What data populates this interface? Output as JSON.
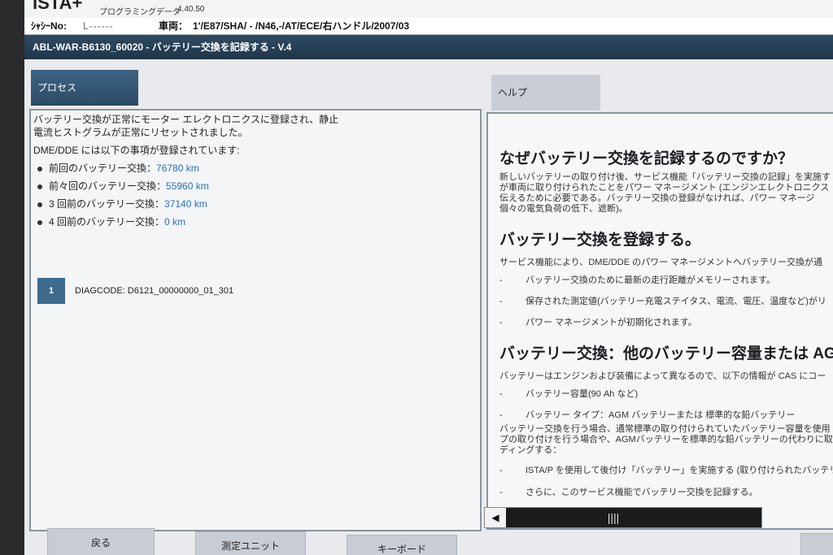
{
  "app": {
    "logo": "ISTA+",
    "subtitle": "プログラミングデータ",
    "version": "4.40.50"
  },
  "vehicle": {
    "vin_label": "ｼｬｼｰNo:",
    "vin_value": "L------",
    "model_label": "車両：",
    "model_value": "1'/E87/SHA/ - /N46,-/AT/ECE/右ハンドル/2007/03"
  },
  "title": "ABL-WAR-B6130_60020 - バッテリー交換を記録する - V.4",
  "tabs": {
    "process": "プロセス",
    "help": "ヘルプ"
  },
  "process": {
    "message": "バッテリー交換が正常にモーター エレクトロニクスに登録され、静止電流ヒストグラムが正常にリセットされました。",
    "subheading": "DME/DDE には以下の事項が登録されています:",
    "history": [
      {
        "label": "前回のバッテリー交換：",
        "km": "76780 km"
      },
      {
        "label": "前々回のバッテリー交換：",
        "km": "55960 km"
      },
      {
        "label": "3 回前のバッテリー交換：",
        "km": "37140 km"
      },
      {
        "label": "4 回前のバッテリー交換：",
        "km": "0 km"
      }
    ],
    "diag_index": "1",
    "diag_code": "DIAGCODE: D6121_00000000_01_301"
  },
  "help": {
    "h1": "なぜバッテリー交換を記録するのですか？",
    "p1": [
      "新しいバッテリーの取り付け後、サービス機能「バッテリー交換の記録」を実施す",
      "が車両に取り付けられたことをパワー マネージメント (エンジンエレクトロニクス",
      "伝えるために必要である。バッテリー交換の登録がなければ、パワー マネージ",
      "個々の電気負荷の低下、遮断)。"
    ],
    "h2": "バッテリー交換を登録する。",
    "p2": "サービス機能により、DME/DDE のパワー マネージメントへバッテリー交換が通",
    "list2": [
      "バッテリー交換のために最新の走行距離がメモリーされます。",
      "保存された測定値(バッテリー充電ステイタス、電流、電圧、温度など)がリ",
      "パワー マネージメントが初期化されます。"
    ],
    "h3": "バッテリー交換：他のバッテリー容量または AGM",
    "p3": "バッテリーはエンジンおよび装備によって異なるので、以下の情報が CAS にコー",
    "list3": [
      "バッテリー容量(90 Ah など)",
      "バッテリー タイプ：AGM バッテリーまたは 標準的な鉛バッテリー"
    ],
    "p4": [
      "バッテリー交換を行う場合、通常標準の取り付けられていたバッテリー容量を使用",
      "プの取り付けを行う場合や、AGMバッテリーを標準的な鉛バッテリーの代わりに取",
      "ディングする："
    ],
    "list4": [
      "ISTA/P を使用して後付け「バッテリー」を実施する (取り付けられたバッテリ",
      "さらに、このサービス機能でバッテリー交換を記録する。"
    ]
  },
  "scroll": {
    "left_arrow": "◀",
    "thumb": "||||"
  },
  "footer": {
    "back": "戻る",
    "measure": "測定ユニット",
    "keyboard": "キーボード"
  }
}
